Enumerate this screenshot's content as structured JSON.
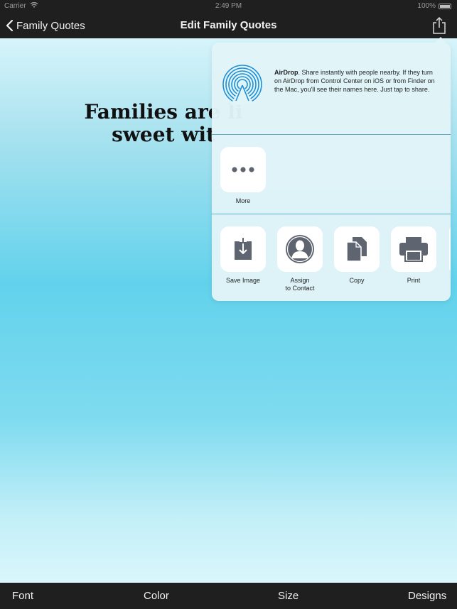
{
  "status_bar": {
    "carrier": "Carrier",
    "time": "2:49 PM",
    "battery": "100%"
  },
  "nav": {
    "back_label": "Family Quotes",
    "title": "Edit Family Quotes"
  },
  "canvas": {
    "quote_line1": "Families are li",
    "quote_line2": "sweet wit"
  },
  "share_sheet": {
    "airdrop_title": "AirDrop",
    "airdrop_text": ". Share instantly with people nearby. If they turn on AirDrop from Control Center on iOS or from Finder on the Mac, you'll see their names here. Just tap to share.",
    "more_label": "More",
    "actions": [
      {
        "label": "Save Image",
        "icon": "save-image-icon"
      },
      {
        "label": "Assign\nto Contact",
        "icon": "contact-icon"
      },
      {
        "label": "Copy",
        "icon": "copy-icon"
      },
      {
        "label": "Print",
        "icon": "print-icon"
      }
    ]
  },
  "toolbar": {
    "font": "Font",
    "color": "Color",
    "size": "Size",
    "designs": "Designs"
  },
  "colors": {
    "bar_background": "#1f1f1f",
    "separator": "#5ab0c8",
    "airdrop_blue": "#1f8fd6",
    "icon_gray": "#5f6570"
  }
}
